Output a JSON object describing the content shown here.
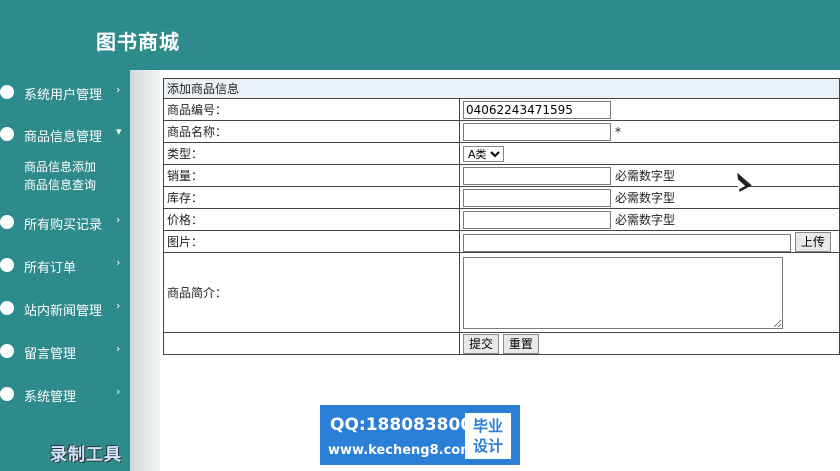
{
  "app": {
    "title": "图书商城"
  },
  "sidebar": {
    "items": [
      {
        "label": "系统用户管理",
        "arrow": "›"
      },
      {
        "label": "商品信息管理",
        "arrow": "▾"
      },
      {
        "label": "所有购买记录",
        "arrow": "›"
      },
      {
        "label": "所有订单",
        "arrow": "›"
      },
      {
        "label": "站内新闻管理",
        "arrow": "›"
      },
      {
        "label": "留言管理",
        "arrow": "›"
      },
      {
        "label": "系统管理",
        "arrow": "›"
      }
    ],
    "subitems": [
      "商品信息添加",
      "商品信息查询"
    ]
  },
  "form": {
    "header": "添加商品信息",
    "code_label": "商品编号：",
    "code_value": "04062243471595",
    "name_label": "商品名称：",
    "name_required": "*",
    "type_label": "类型：",
    "type_selected": "A类",
    "sales_label": "销量：",
    "stock_label": "库存：",
    "price_label": "价格：",
    "numeric_hint": "必需数字型",
    "image_label": "图片：",
    "upload_label": "上传",
    "intro_label": "商品简介：",
    "submit_label": "提交",
    "reset_label": "重置"
  },
  "watermark": {
    "qq": "QQ:188083800",
    "url": "www.kecheng8.com",
    "badge_line1": "毕业",
    "badge_line2": "设计"
  },
  "recorder": {
    "label": "录制工具"
  }
}
